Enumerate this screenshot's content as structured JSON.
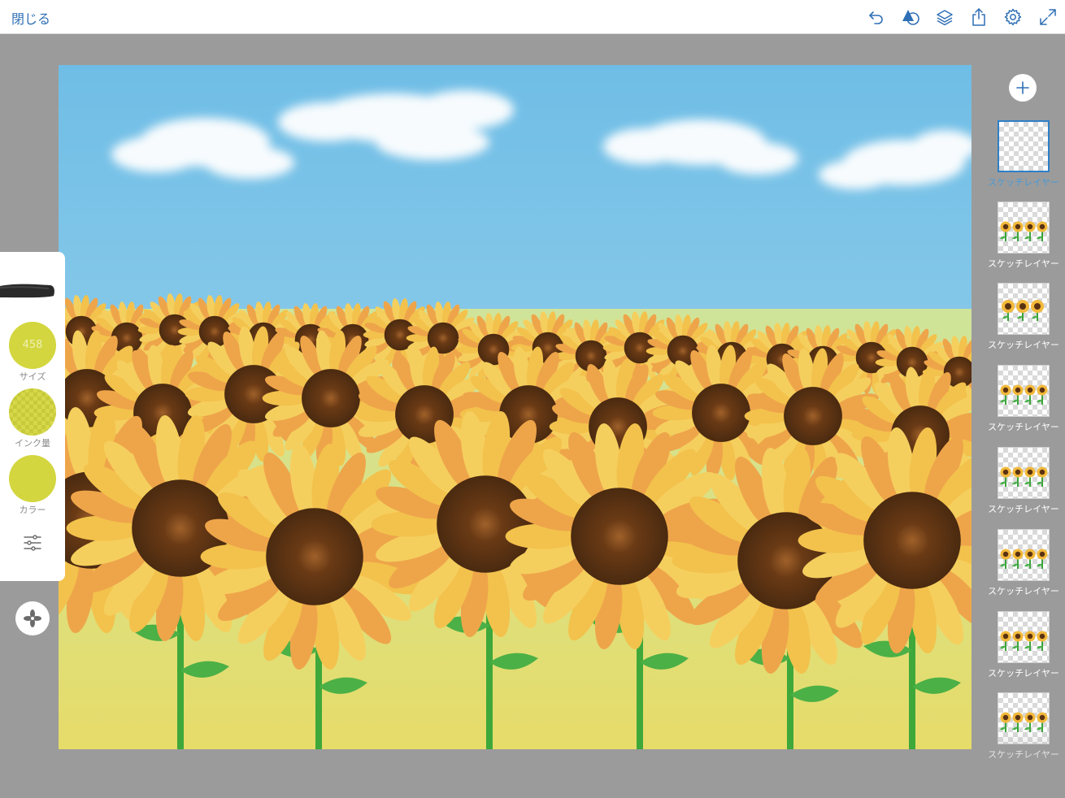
{
  "topbar": {
    "close_label": "閉じる",
    "tools": [
      {
        "name": "undo-icon"
      },
      {
        "name": "shape-tool-icon"
      },
      {
        "name": "layers-icon"
      },
      {
        "name": "share-icon"
      },
      {
        "name": "settings-gear-icon"
      },
      {
        "name": "fullscreen-expand-icon"
      }
    ],
    "accent_color": "#2f6fb5"
  },
  "brush_panel": {
    "size_value": "458",
    "size_label": "サイズ",
    "ink_label": "インク量",
    "color_label": "カラー",
    "swatch_color": "#d3d63f"
  },
  "layers": {
    "add_icon": "plus-icon",
    "items": [
      {
        "label": "スケッチレイヤー",
        "selected": true
      },
      {
        "label": "スケッチレイヤー",
        "selected": false
      },
      {
        "label": "スケッチレイヤー",
        "selected": false
      },
      {
        "label": "スケッチレイヤー",
        "selected": false
      },
      {
        "label": "スケッチレイヤー",
        "selected": false
      },
      {
        "label": "スケッチレイヤー",
        "selected": false
      },
      {
        "label": "スケッチレイヤー",
        "selected": false
      },
      {
        "label": "スケッチレイヤー",
        "selected": false
      }
    ]
  },
  "canvas": {
    "subject": "sunflower-field-painting"
  }
}
